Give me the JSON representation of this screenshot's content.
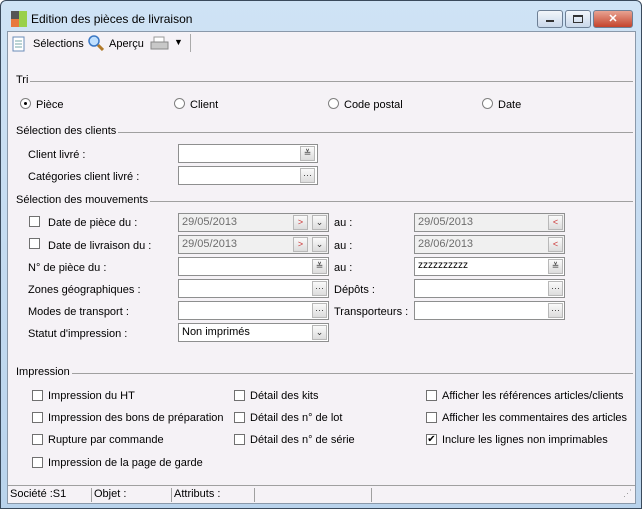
{
  "window": {
    "title": "Edition des pièces de livraison"
  },
  "toolbar": {
    "selections": "Sélections",
    "apercu": "Aperçu"
  },
  "tri": {
    "label": "Tri",
    "options": [
      "Pièce",
      "Client",
      "Code postal",
      "Date"
    ],
    "selected": "Pièce"
  },
  "clients": {
    "label": "Sélection des clients",
    "client_livre": "Client livré :",
    "categories": "Catégories client livré :",
    "client_value": "",
    "categories_value": ""
  },
  "mouvements": {
    "label": "Sélection des mouvements",
    "date_piece": "Date de pièce du :",
    "date_piece_from": "29/05/2013",
    "date_piece_to": "29/05/2013",
    "date_livraison": "Date de livraison du :",
    "date_livraison_from": "29/05/2013",
    "date_livraison_to": "28/06/2013",
    "num_piece": "N° de pièce du :",
    "num_piece_from": "",
    "num_piece_to": "zzzzzzzzzz",
    "au": "au :",
    "zones": "Zones géographiques :",
    "depots": "Dépôts :",
    "modes": "Modes de transport :",
    "transporteurs": "Transporteurs :",
    "statut": "Statut d'impression :",
    "statut_value": "Non imprimés"
  },
  "impression": {
    "label": "Impression",
    "options": [
      {
        "label": "Impression du HT",
        "checked": false
      },
      {
        "label": "Impression des bons de préparation",
        "checked": false
      },
      {
        "label": "Rupture par commande",
        "checked": false
      },
      {
        "label": "Impression de la page de garde",
        "checked": false
      },
      {
        "label": "Détail des kits",
        "checked": false
      },
      {
        "label": "Détail des n° de lot",
        "checked": false
      },
      {
        "label": "Détail des n° de série",
        "checked": false
      },
      {
        "label": "Afficher les références articles/clients",
        "checked": false
      },
      {
        "label": "Afficher les commentaires des articles",
        "checked": false
      },
      {
        "label": "Inclure les lignes non imprimables",
        "checked": true
      }
    ]
  },
  "status": {
    "societe": "Société :S1",
    "objet": "Objet :",
    "attributs": "Attributs :"
  }
}
